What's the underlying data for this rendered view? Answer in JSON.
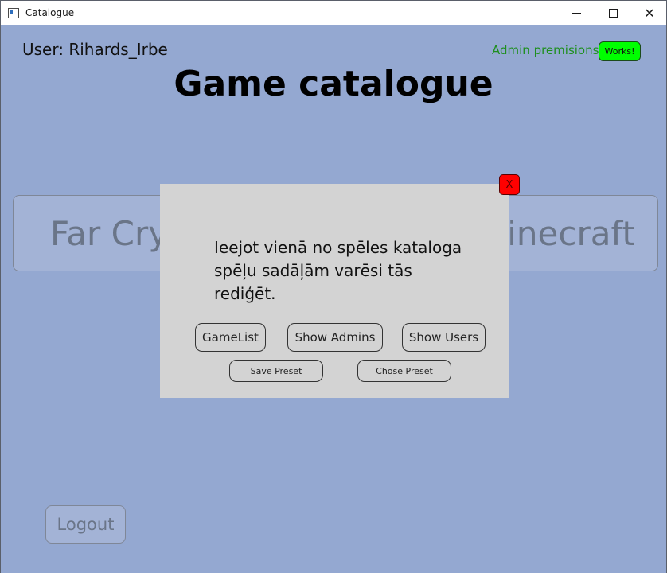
{
  "window": {
    "title": "Catalogue",
    "controls": {
      "minimize_icon": "minimize-icon",
      "maximize_icon": "maximize-icon",
      "close_symbol": "✕"
    }
  },
  "header": {
    "user_label": "User: Rihards_Irbe",
    "admin_label": "Admin premisions:",
    "admin_status": "Works!",
    "title": "Game catalogue"
  },
  "games": [
    {
      "title": "Far Cry"
    },
    {
      "title": "Minecraft"
    }
  ],
  "logout_label": "Logout",
  "modal": {
    "close_label": "X",
    "message": "Ieejot vienā no spēles kataloga spēļu sadāļām varēsi tās rediģēt.",
    "buttons": {
      "gamelist": "GameList",
      "show_admins": "Show Admins",
      "show_users": "Show Users",
      "save_preset": "Save Preset",
      "chose_preset": "Chose Preset"
    }
  },
  "colors": {
    "background": "#94a8d1",
    "modal": "#d3d3d3",
    "admin_green": "#00ff00",
    "close_red": "#ff0000"
  }
}
